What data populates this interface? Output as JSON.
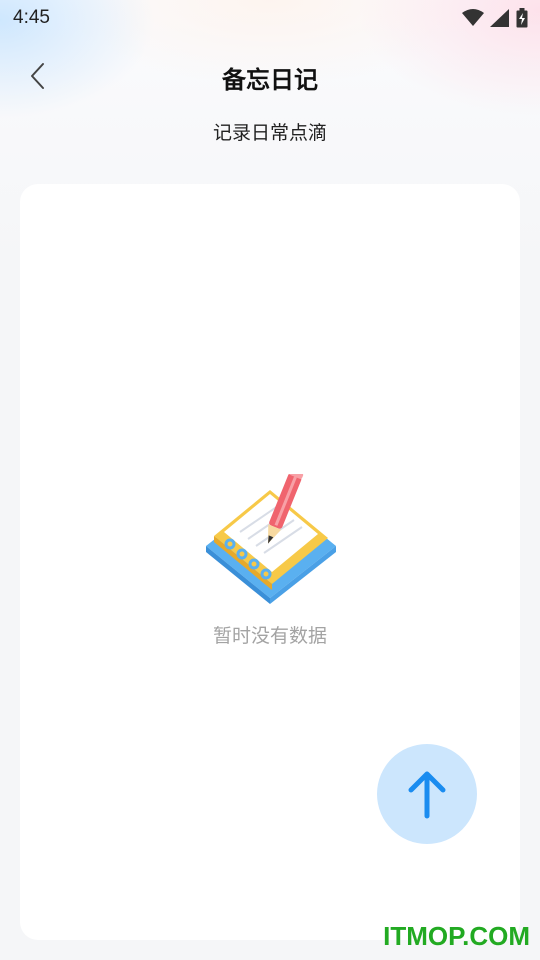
{
  "status_bar": {
    "time": "4:45",
    "icons": [
      "wifi-icon",
      "cellular-signal-icon",
      "battery-charging-icon"
    ]
  },
  "header": {
    "back_icon": "chevron-left-icon",
    "title": "备忘日记"
  },
  "subtitle": "记录日常点滴",
  "empty_state": {
    "illustration": "notebook-pencil-icon",
    "message": "暂时没有数据"
  },
  "fab": {
    "icon": "arrow-up-icon",
    "color": "#1a8cf0",
    "background": "#cce6fd"
  },
  "watermark": "ITMOP.COM",
  "colors": {
    "accent": "#1a8cf0",
    "watermark": "#22aa22"
  }
}
